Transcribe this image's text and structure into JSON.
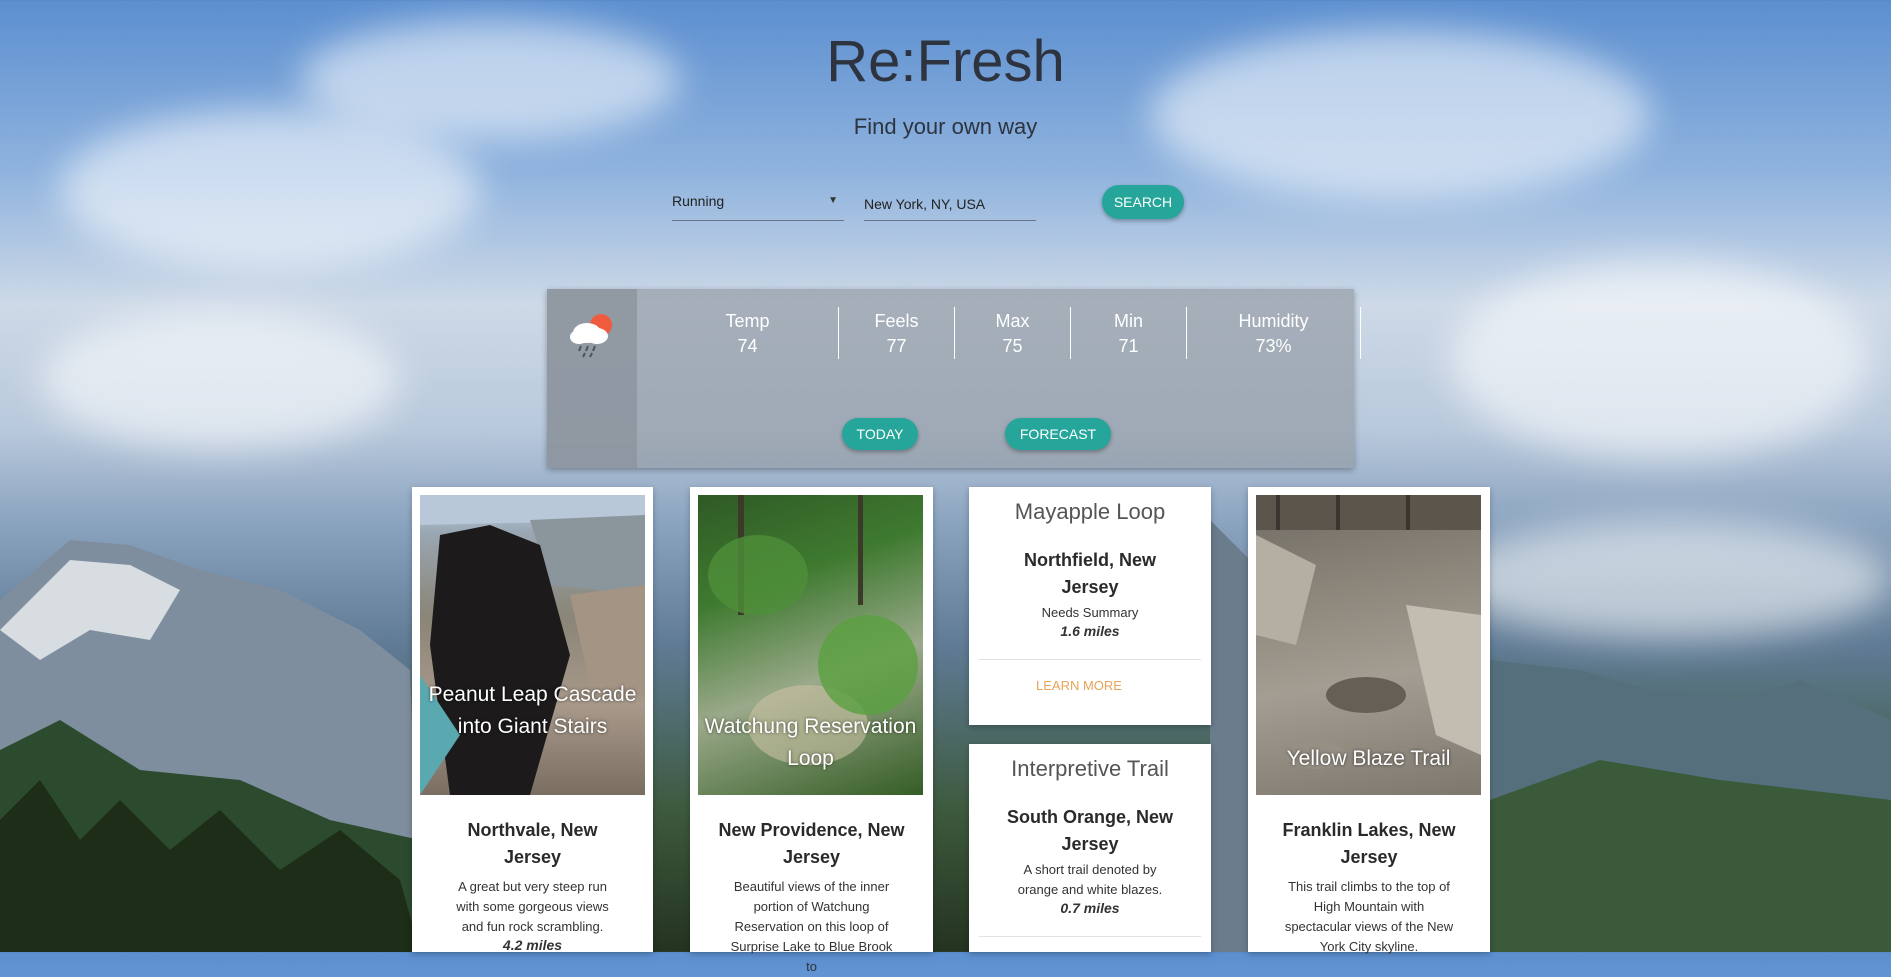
{
  "header": {
    "title": "Re:Fresh",
    "subtitle": "Find your own way"
  },
  "search": {
    "activity_value": "Running",
    "location_value": "New York, NY, USA",
    "button_label": "SEARCH"
  },
  "weather": {
    "icon": "cloud-rain-sun-icon",
    "stats": [
      {
        "label": "Temp",
        "value": "74"
      },
      {
        "label": "Feels",
        "value": "77"
      },
      {
        "label": "Max",
        "value": "75"
      },
      {
        "label": "Min",
        "value": "71"
      },
      {
        "label": "Humidity",
        "value": "73%"
      }
    ],
    "today_label": "TODAY",
    "forecast_label": "FORECAST"
  },
  "trails": [
    {
      "image_title": "Peanut Leap Cascade into Giant Stairs",
      "location": "Northvale, New Jersey",
      "summary": "A great but very steep run with some gorgeous views and fun rock scrambling.",
      "length": "4.2 miles"
    },
    {
      "image_title": "Watchung Reservation Loop",
      "location": "New Providence, New Jersey",
      "summary": "Beautiful views of the inner portion of Watchung Reservation on this loop of Surprise Lake to Blue Brook to"
    },
    {
      "title": "Mayapple Loop",
      "location": "Northfield, New Jersey",
      "summary": "Needs Summary",
      "length": "1.6 miles",
      "link_label": "LEARN MORE"
    },
    {
      "title": "Interpretive Trail",
      "location": "South Orange, New Jersey",
      "summary": "A short trail denoted by orange and white blazes.",
      "length": "0.7 miles"
    },
    {
      "image_title": "Yellow Blaze Trail",
      "location": "Franklin Lakes, New Jersey",
      "summary": "This trail climbs to the top of High Mountain with spectacular views of the New York City skyline."
    }
  ],
  "colors": {
    "accent": "#26a69a",
    "link": "#e8a35a"
  }
}
